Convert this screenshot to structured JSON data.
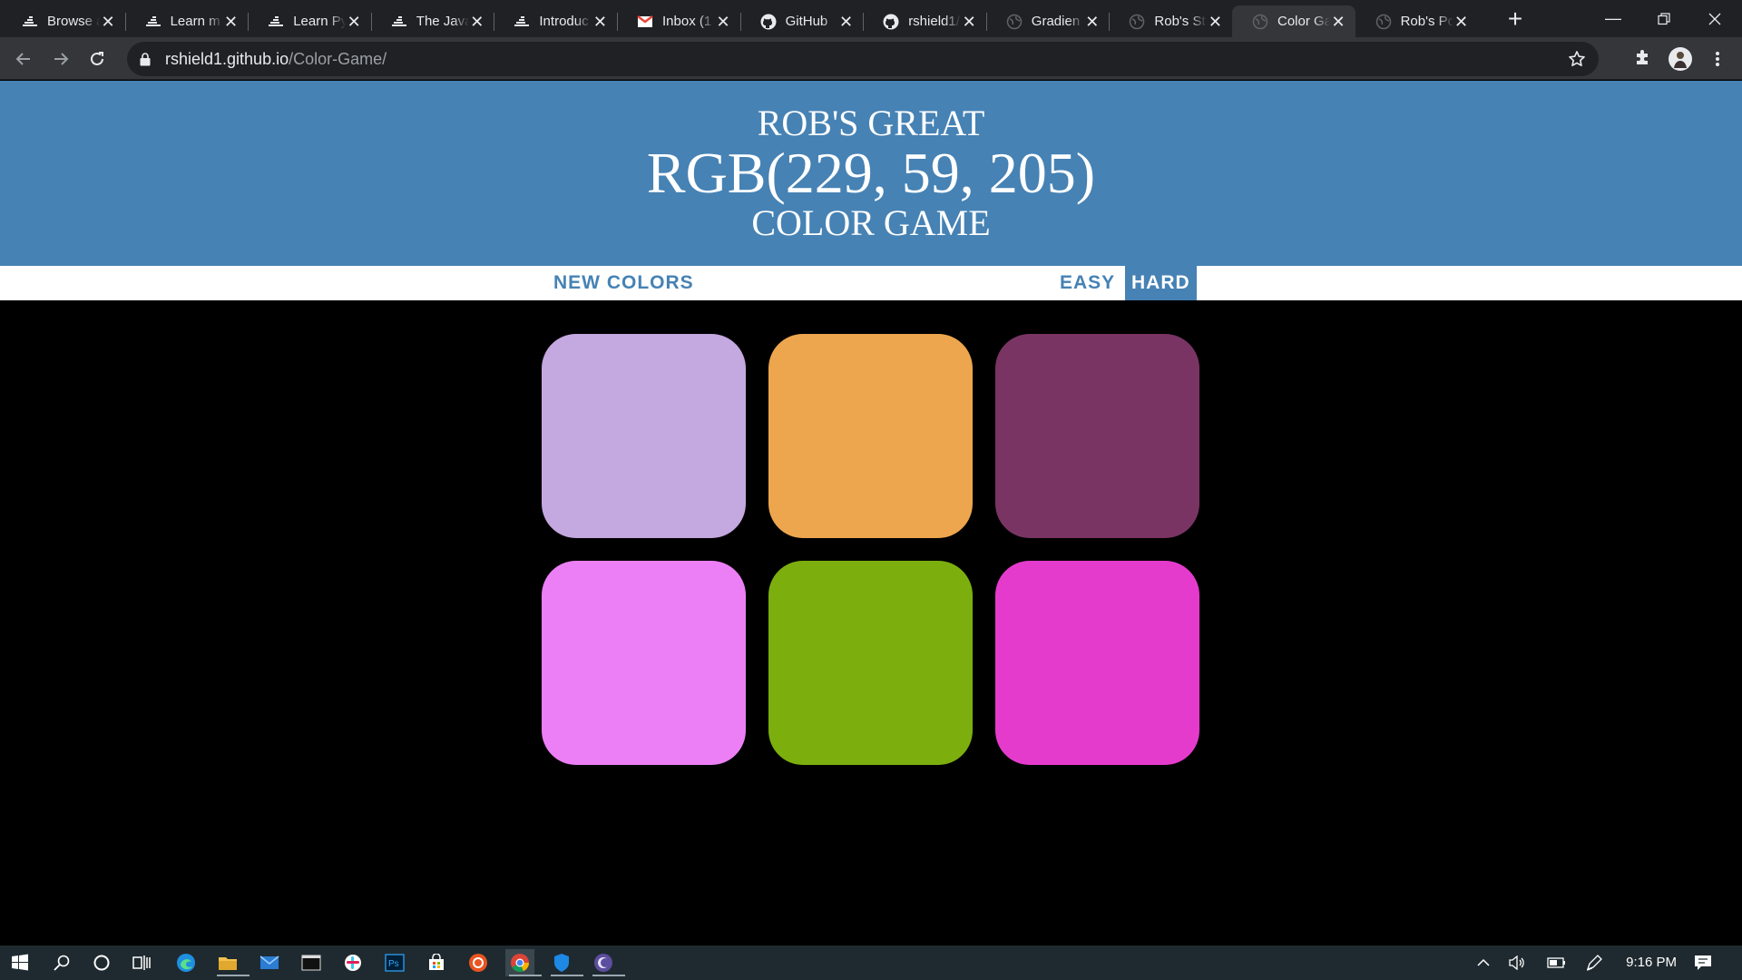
{
  "browser": {
    "tabs": [
      {
        "title": "Browse a",
        "icon": "freecodecamp-icon",
        "active": false
      },
      {
        "title": "Learn m",
        "icon": "freecodecamp-icon",
        "active": false
      },
      {
        "title": "Learn Py",
        "icon": "freecodecamp-icon",
        "active": false
      },
      {
        "title": "The Java",
        "icon": "freecodecamp-icon",
        "active": false
      },
      {
        "title": "Introduc",
        "icon": "freecodecamp-icon",
        "active": false
      },
      {
        "title": "Inbox (1",
        "icon": "gmail-icon",
        "active": false
      },
      {
        "title": "GitHub",
        "icon": "github-icon",
        "active": false
      },
      {
        "title": "rshield1/",
        "icon": "github-icon",
        "active": false
      },
      {
        "title": "Gradien",
        "icon": "globe-icon",
        "active": false
      },
      {
        "title": "Rob's St",
        "icon": "globe-icon",
        "active": false
      },
      {
        "title": "Color Ga",
        "icon": "globe-icon",
        "active": true
      },
      {
        "title": "Rob's Po",
        "icon": "globe-icon",
        "active": false
      }
    ],
    "url_host": "rshield1.github.io",
    "url_path": "/Color-Game/"
  },
  "game": {
    "title_line1": "Rob's Great",
    "rgb_display": "RGB(229, 59, 205)",
    "title_line2": "Color Game",
    "new_colors_label": "New Colors",
    "easy_label": "Easy",
    "hard_label": "Hard",
    "selected_mode": "hard",
    "header_color": "#4682b4",
    "squares": [
      {
        "color": "#c4a8e0"
      },
      {
        "color": "#eda64e"
      },
      {
        "color": "#7a3464"
      },
      {
        "color": "#ec7ff5"
      },
      {
        "color": "#7caf0e"
      },
      {
        "color": "#e53bcd"
      }
    ]
  },
  "taskbar": {
    "clock": "9:16 PM"
  }
}
